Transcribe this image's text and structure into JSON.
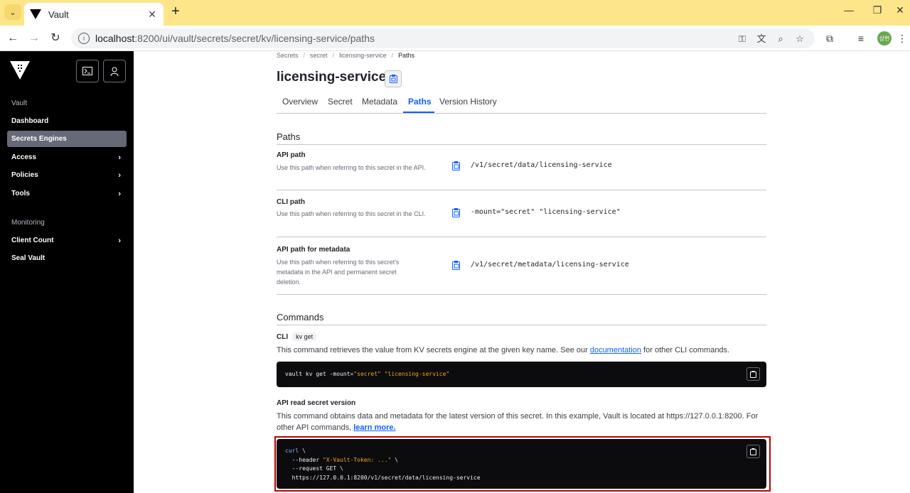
{
  "browser": {
    "tab_title": "Vault",
    "url_host": "localhost",
    "url_path": ":8200/ui/vault/secrets/secret/kv/licensing-service/paths",
    "profile_initials": "상현"
  },
  "sidebar": {
    "section_vault": "Vault",
    "items": [
      {
        "label": "Dashboard"
      },
      {
        "label": "Secrets Engines"
      },
      {
        "label": "Access"
      },
      {
        "label": "Policies"
      },
      {
        "label": "Tools"
      }
    ],
    "section_monitoring": "Monitoring",
    "monitoring_items": [
      {
        "label": "Client Count"
      },
      {
        "label": "Seal Vault"
      }
    ]
  },
  "breadcrumb": [
    "Secrets",
    "secret",
    "licensing-service",
    "Paths"
  ],
  "page_title": "licensing-service",
  "tabs": [
    "Overview",
    "Secret",
    "Metadata",
    "Paths",
    "Version History"
  ],
  "paths": {
    "heading": "Paths",
    "rows": [
      {
        "label": "API path",
        "help": "Use this path when referring to this secret in the API.",
        "value": "/v1/secret/data/licensing-service"
      },
      {
        "label": "CLI path",
        "help": "Use this path when referring to this secret in the CLI.",
        "value": "-mount=\"secret\" \"licensing-service\""
      },
      {
        "label": "API path for metadata",
        "help": "Use this path when referring to this secret's metadata in the API and permanent secret deletion.",
        "value": "/v1/secret/metadata/licensing-service"
      }
    ]
  },
  "commands": {
    "heading": "Commands",
    "cli": {
      "label": "CLI",
      "badge": "kv get",
      "desc_before": "This command retrieves the value from KV secrets engine at the given key name. See our ",
      "desc_link": "documentation",
      "desc_after": " for other CLI commands.",
      "code_prefix": "vault kv get -mount=",
      "code_mount": "\"secret\"",
      "code_name": "\"licensing-service\""
    },
    "api": {
      "label": "API read secret version",
      "desc_before": "This command obtains data and metadata for the latest version of this secret. In this example, Vault is located at https://127.0.0.1:8200. For other API commands, ",
      "desc_link": "learn more.",
      "code_curl": "curl",
      "code_bs1": " \\",
      "code_header_flag": "  --header ",
      "code_header_val": "\"X-Vault-Token: ...\"",
      "code_bs2": " \\",
      "code_request": "  --request GET \\",
      "code_url": "  https://127.0.0.1:8200/v1/secret/data/licensing-service"
    }
  },
  "colors": {
    "accent": "#1060ff",
    "sidebar_bg": "#000000",
    "active_item_bg": "#656a76",
    "highlight_border": "#c00000"
  }
}
